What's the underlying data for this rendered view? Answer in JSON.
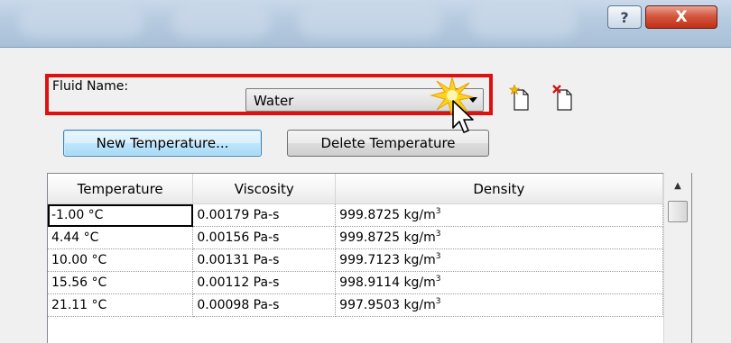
{
  "titlebar": {
    "help_label": "?",
    "close_label": "X"
  },
  "fluid": {
    "label": "Fluid Name:",
    "selected": "Water"
  },
  "icons": {
    "new_fluid": "new-file-star-icon",
    "delete_fluid": "delete-file-x-icon",
    "highlight": "sparkle-highlight-icon",
    "pointer": "mouse-pointer-icon"
  },
  "buttons": {
    "new_temperature": "New Temperature...",
    "delete_temperature": "Delete Temperature"
  },
  "table": {
    "headers": [
      "Temperature",
      "Viscosity",
      "Density"
    ],
    "density_unit": "kg/m",
    "density_exp": "3",
    "rows": [
      {
        "temperature": "-1.00 °C",
        "viscosity": "0.00179 Pa-s",
        "density": "999.8725"
      },
      {
        "temperature": "4.44 °C",
        "viscosity": "0.00156 Pa-s",
        "density": "999.8725"
      },
      {
        "temperature": "10.00 °C",
        "viscosity": "0.00131 Pa-s",
        "density": "999.7123"
      },
      {
        "temperature": "15.56 °C",
        "viscosity": "0.00112 Pa-s",
        "density": "998.9114"
      },
      {
        "temperature": "21.11 °C",
        "viscosity": "0.00098 Pa-s",
        "density": "997.9503"
      }
    ]
  },
  "colors": {
    "highlight_border": "#e01010",
    "close_button": "#c9391f",
    "accent_button": "#bee6fd"
  }
}
